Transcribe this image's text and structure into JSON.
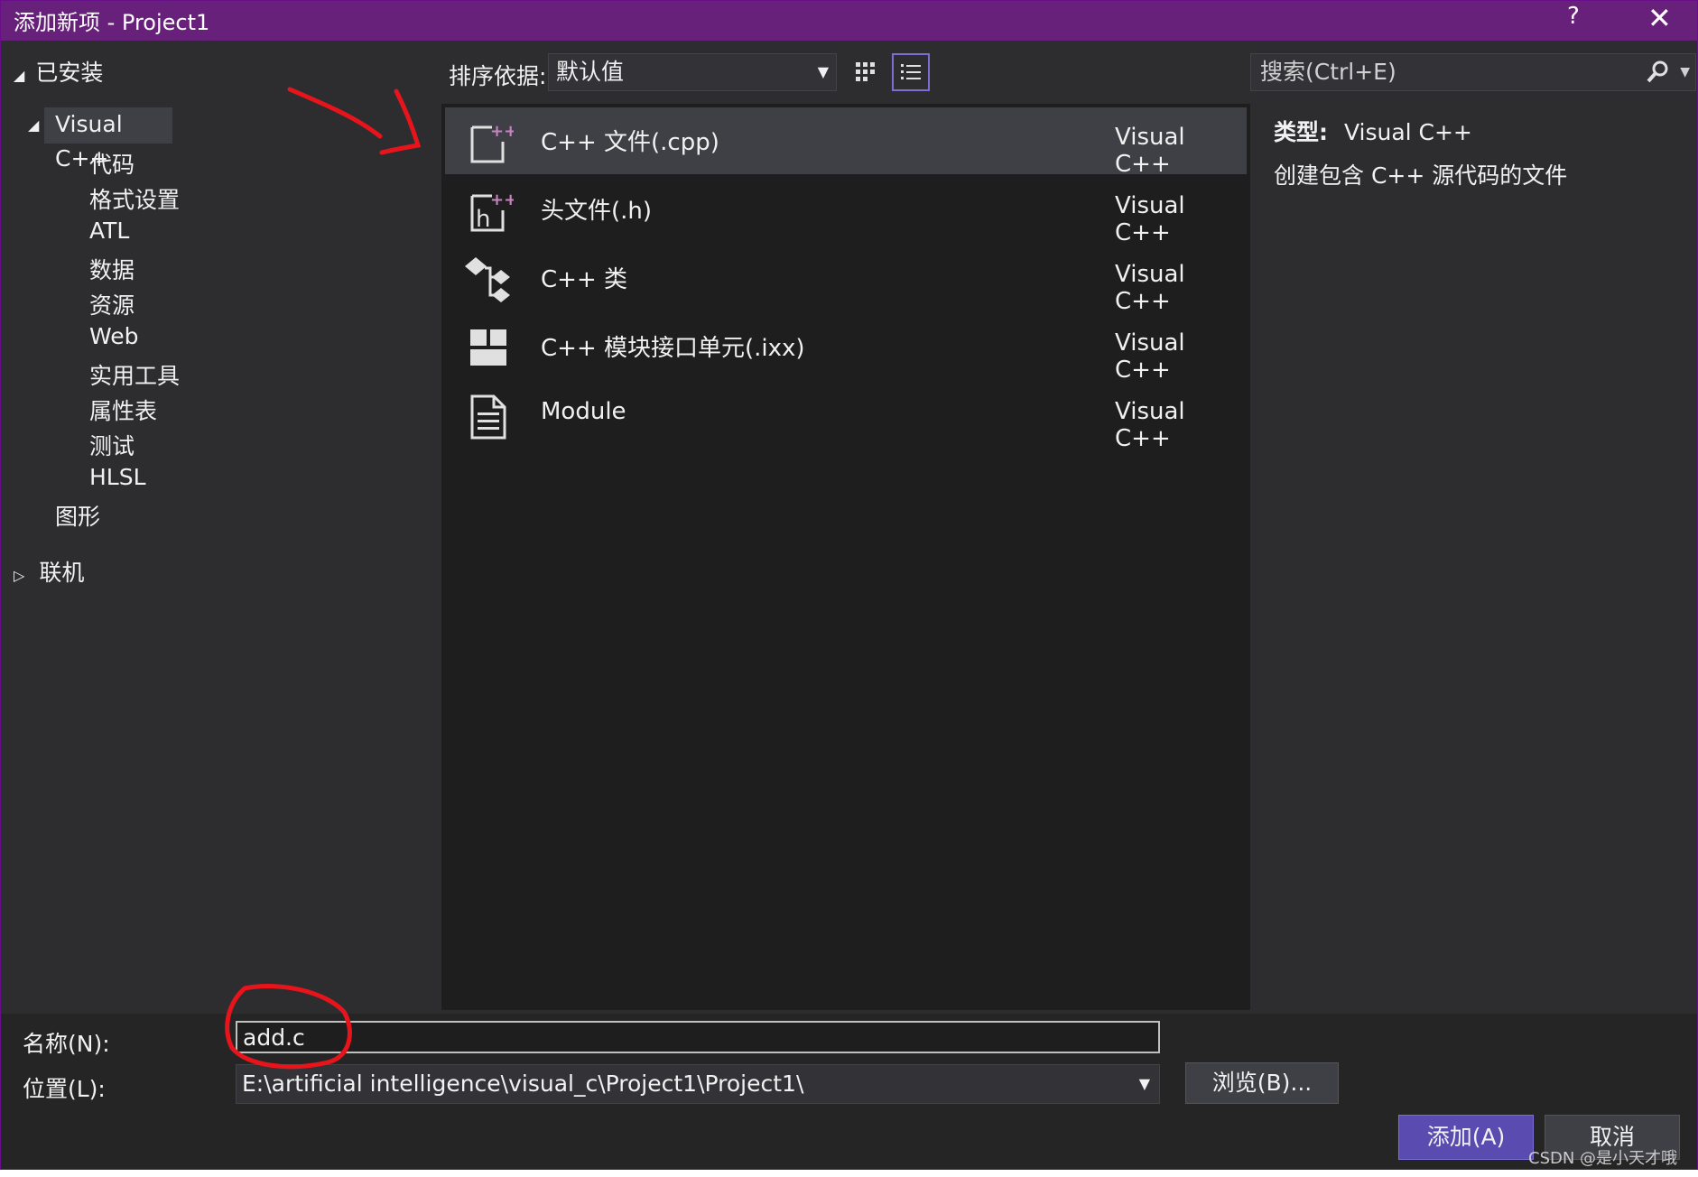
{
  "window": {
    "title": "添加新项 - Project1",
    "help": "?",
    "close": "✕"
  },
  "tree": {
    "installed": "已安装",
    "visual_cpp": "Visual C++",
    "children": [
      "代码",
      "格式设置",
      "ATL",
      "数据",
      "资源",
      "Web",
      "实用工具",
      "属性表",
      "测试",
      "HLSL"
    ],
    "graphics": "图形",
    "online": "联机"
  },
  "toolbar": {
    "sort_label": "排序依据:",
    "sort_value": "默认值",
    "search_placeholder": "搜索(Ctrl+E)"
  },
  "templates": [
    {
      "name": "C++ 文件(.cpp)",
      "lang": "Visual C++",
      "icon": "cpp-file-icon",
      "selected": true
    },
    {
      "name": "头文件(.h)",
      "lang": "Visual C++",
      "icon": "header-file-icon",
      "selected": false
    },
    {
      "name": "C++ 类",
      "lang": "Visual C++",
      "icon": "cpp-class-icon",
      "selected": false
    },
    {
      "name": "C++ 模块接口单元(.ixx)",
      "lang": "Visual C++",
      "icon": "module-interface-icon",
      "selected": false
    },
    {
      "name": "Module",
      "lang": "Visual C++",
      "icon": "module-document-icon",
      "selected": false
    }
  ],
  "details": {
    "type_label": "类型:",
    "type_value": "Visual C++",
    "description": "创建包含 C++ 源代码的文件"
  },
  "form": {
    "name_label": "名称(N):",
    "name_value": "add.c",
    "location_label": "位置(L):",
    "location_value": "E:\\artificial intelligence\\visual_c\\Project1\\Project1\\",
    "browse": "浏览(B)...",
    "add": "添加(A)",
    "cancel": "取消"
  },
  "watermark": "CSDN @是小天才哦",
  "colors": {
    "title_bar": "#68217a",
    "accent": "#5a4bb0",
    "annotation": "#e8141c"
  }
}
